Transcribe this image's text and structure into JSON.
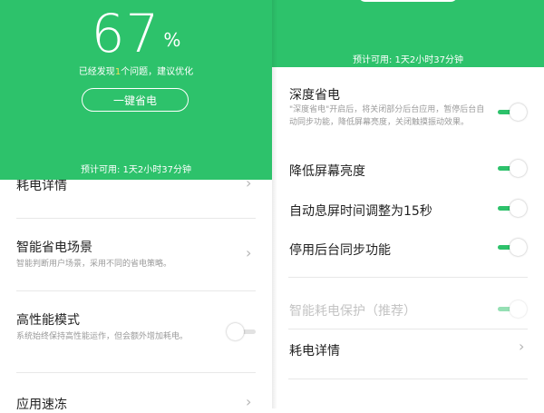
{
  "left": {
    "percent": "67",
    "percent_sign": "%",
    "found_prefix": "已经发现",
    "found_count": "1",
    "found_suffix": "个问题，建议优化",
    "one_key_button": "一键省电",
    "estimate": "预计可用: 1天2小时37分钟",
    "rows": [
      {
        "title": "耗电详情"
      },
      {
        "title": "智能省电场景",
        "subtitle": "智能判断用户场景，采用不同的省电策略。"
      },
      {
        "title": "高性能模式",
        "subtitle": "系统始终保持高性能运作，但会额外增加耗电。"
      },
      {
        "title": "应用速冻"
      }
    ]
  },
  "right": {
    "estimate": "预计可用: 1天2小时37分钟",
    "deep": {
      "title": "深度省电",
      "subtitle": "\"深度省电\"开启后，将关闭部分后台应用，暂停后台自动同步功能，降低屏幕亮度，关闭触摸振动效果。"
    },
    "items": [
      {
        "title": "降低屏幕亮度"
      },
      {
        "title": "自动息屏时间调整为15秒"
      },
      {
        "title": "停用后台同步功能"
      },
      {
        "title": "智能耗电保护（推荐）"
      },
      {
        "title": "耗电详情"
      }
    ]
  },
  "colors": {
    "accent_green": "#2dc26b",
    "highlight_yellow": "#f3e35a"
  }
}
